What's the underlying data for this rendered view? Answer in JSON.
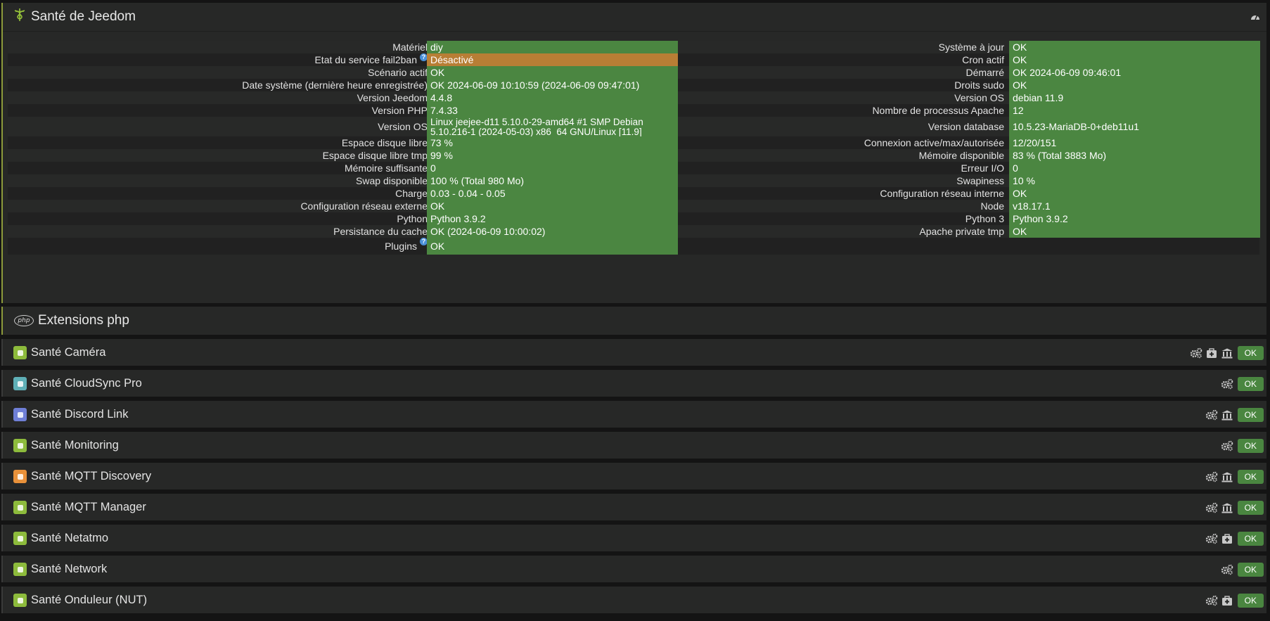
{
  "health": {
    "title": "Santé de Jeedom",
    "left": [
      {
        "label": "Matériel",
        "value": "diy",
        "status": "ok"
      },
      {
        "label": "Etat du service fail2ban",
        "value": "Désactivé",
        "status": "warn",
        "help": true
      },
      {
        "label": "Scénario actif",
        "value": "OK",
        "status": "ok"
      },
      {
        "label": "Date système (dernière heure enregistrée)",
        "value": "OK 2024-06-09 10:10:59 (2024-06-09 09:47:01)",
        "status": "ok"
      },
      {
        "label": "Version Jeedom",
        "value": "4.4.8",
        "status": "ok"
      },
      {
        "label": "Version PHP",
        "value": "7.4.33",
        "status": "ok"
      },
      {
        "label": "Version OS",
        "value": "Linux jeejee-d11 5.10.0-29-amd64 #1 SMP Debian 5.10.216-1 (2024-05-03) x86_64 GNU/Linux [11.9]",
        "status": "ok"
      },
      {
        "label": "Espace disque libre",
        "value": "73 %",
        "status": "ok"
      },
      {
        "label": "Espace disque libre tmp",
        "value": "99 %",
        "status": "ok"
      },
      {
        "label": "Mémoire suffisante",
        "value": "0",
        "status": "ok"
      },
      {
        "label": "Swap disponible",
        "value": "100 % (Total 980 Mo)",
        "status": "ok"
      },
      {
        "label": "Charge",
        "value": "0.03 - 0.04 - 0.05",
        "status": "ok"
      },
      {
        "label": "Configuration réseau externe",
        "value": "OK",
        "status": "ok"
      },
      {
        "label": "Python",
        "value": "Python 3.9.2",
        "status": "ok"
      },
      {
        "label": "Persistance du cache",
        "value": "OK (2024-06-09 10:00:02)",
        "status": "ok"
      },
      {
        "label": "Plugins",
        "value": "OK",
        "status": "ok",
        "help": true
      }
    ],
    "right": [
      {
        "label": "Système à jour",
        "value": "OK"
      },
      {
        "label": "Cron actif",
        "value": "OK"
      },
      {
        "label": "Démarré",
        "value": "OK 2024-06-09 09:46:01"
      },
      {
        "label": "Droits sudo",
        "value": "OK"
      },
      {
        "label": "Version OS",
        "value": "debian 11.9"
      },
      {
        "label": "Nombre de processus Apache",
        "value": "12"
      },
      {
        "label": "Version database",
        "value": "10.5.23-MariaDB-0+deb11u1"
      },
      {
        "label": "Connexion active/max/autorisée",
        "value": "12/20/151"
      },
      {
        "label": "Mémoire disponible",
        "value": "83 % (Total 3883 Mo)"
      },
      {
        "label": "Erreur I/O",
        "value": "0"
      },
      {
        "label": "Swapiness",
        "value": "10 %"
      },
      {
        "label": "Configuration réseau interne",
        "value": "OK"
      },
      {
        "label": "Node",
        "value": "v18.17.1"
      },
      {
        "label": "Python 3",
        "value": "Python 3.9.2"
      },
      {
        "label": "Apache private tmp",
        "value": "OK"
      }
    ]
  },
  "extensions": {
    "title": "Extensions php",
    "logo_text": "php"
  },
  "plugins": [
    {
      "name": "Santé Caméra",
      "icon_color": "#8dbb3c",
      "actions": [
        "gears-icon",
        "medkit-icon",
        "bank-icon"
      ],
      "status": "OK"
    },
    {
      "name": "Santé CloudSync Pro",
      "icon_color": "#5fb0b7",
      "actions": [
        "gears-icon"
      ],
      "status": "OK"
    },
    {
      "name": "Santé Discord Link",
      "icon_color": "#6f7fd6",
      "actions": [
        "gears-icon",
        "bank-icon"
      ],
      "status": "OK"
    },
    {
      "name": "Santé Monitoring",
      "icon_color": "#8dbb3c",
      "actions": [
        "gears-icon"
      ],
      "status": "OK"
    },
    {
      "name": "Santé MQTT Discovery",
      "icon_color": "#e8913a",
      "actions": [
        "gears-icon",
        "bank-icon"
      ],
      "status": "OK"
    },
    {
      "name": "Santé MQTT Manager",
      "icon_color": "#8dbb3c",
      "actions": [
        "gears-icon",
        "bank-icon"
      ],
      "status": "OK"
    },
    {
      "name": "Santé Netatmo",
      "icon_color": "#8dbb3c",
      "actions": [
        "gears-icon",
        "medkit-icon"
      ],
      "status": "OK"
    },
    {
      "name": "Santé Network",
      "icon_color": "#8dbb3c",
      "actions": [
        "gears-icon"
      ],
      "status": "OK"
    },
    {
      "name": "Santé Onduleur (NUT)",
      "icon_color": "#8dbb3c",
      "actions": [
        "gears-icon",
        "medkit-icon"
      ],
      "status": "OK"
    }
  ],
  "colors": {
    "ok": "#4b8641",
    "warn": "#b87e35",
    "accent": "#8d9b3b"
  }
}
